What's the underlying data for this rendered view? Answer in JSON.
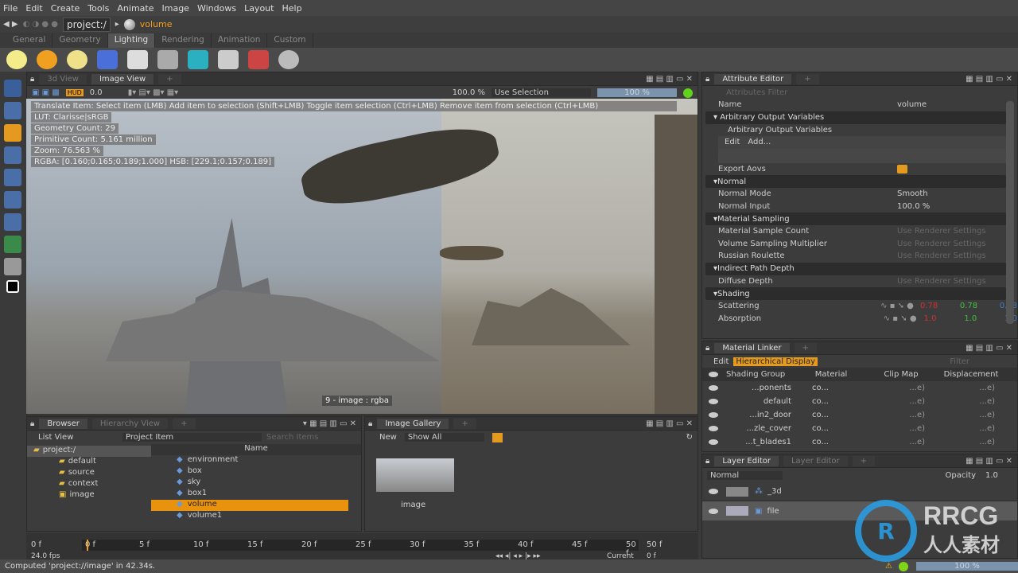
{
  "menu": [
    "File",
    "Edit",
    "Create",
    "Tools",
    "Animate",
    "Image",
    "Windows",
    "Layout",
    "Help"
  ],
  "nav": {
    "path": "project:/",
    "selected": "volume"
  },
  "shelf_tabs": [
    "General",
    "Geometry",
    "Lighting",
    "Rendering",
    "Animation",
    "Custom"
  ],
  "shelf_active": "Lighting",
  "shelf_icons": [
    "bulb-light-icon",
    "sun-light-icon",
    "point-light-icon",
    "spot-light-icon",
    "area-light-icon",
    "line-light-icon",
    "sphere-light-icon",
    "distant-light-icon",
    "gi-light-icon",
    "env-light-icon"
  ],
  "viewport": {
    "tabs": [
      "3d View",
      "Image View"
    ],
    "active_tab": "Image View",
    "exposure": "0.0",
    "zoom": "100.0 %",
    "selection_mode": "Use Selection",
    "progress": "100 %",
    "hud": [
      "Translate Item: Select item (LMB)  Add item to selection (Shift+LMB)  Toggle item selection (Ctrl+LMB)  Remove item from selection (Ctrl+LMB)",
      "LUT: Clarisse|sRGB",
      "Geometry Count: 29",
      "Primitive Count: 5.161 million",
      "Zoom: 76.563 %",
      "RGBA: [0.160;0.165;0.189;1.000] HSB: [229.1;0.157;0.189]"
    ],
    "image_label": "9 - image : rgba"
  },
  "attribute_editor": {
    "title": "Attribute Editor",
    "filter_placeholder": "Attributes Filter",
    "name_label": "Name",
    "name_value": "volume",
    "sections": [
      {
        "title": "Arbitrary Output Variables",
        "rows": []
      },
      {
        "title": "Normal",
        "rows": [
          {
            "label": "Normal Mode",
            "value": "Smooth"
          },
          {
            "label": "Normal Input",
            "value": "100.0 %"
          }
        ]
      },
      {
        "title": "Material Sampling",
        "rows": [
          {
            "label": "Material Sample Count",
            "value": "Use Renderer Settings"
          },
          {
            "label": "Volume Sampling Multiplier",
            "value": "Use Renderer Settings"
          },
          {
            "label": "Russian Roulette",
            "value": "Use Renderer Settings"
          }
        ]
      },
      {
        "title": "Indirect Path Depth",
        "rows": [
          {
            "label": "Diffuse Depth",
            "value": "Use Renderer Settings"
          }
        ]
      },
      {
        "title": "Shading",
        "rows": []
      }
    ],
    "aov_sub": "Arbitrary Output Variables",
    "aov_edit": "Edit",
    "aov_add": "Add...",
    "export_aovs": "Export Aovs",
    "scattering": {
      "label": "Scattering",
      "r": "0.78",
      "g": "0.78",
      "b": "0.78"
    },
    "absorption": {
      "label": "Absorption",
      "r": "1.0",
      "g": "1.0",
      "b": "1.0"
    }
  },
  "material_linker": {
    "title": "Material Linker",
    "edit": "Edit",
    "mode": "Hierarchical Display",
    "filter_placeholder": "Filter",
    "columns": [
      "Shading Group",
      "Material",
      "Clip Map",
      "Displacement"
    ],
    "rows": [
      "...ponents",
      "default",
      "...in2_door",
      "...zle_cover",
      "...t_blades1"
    ],
    "material_value": "co...",
    "map_value": "...e)"
  },
  "layer_editor": {
    "tabs": [
      "Layer Editor",
      "Layer Editor"
    ],
    "blend": "Normal",
    "opacity_label": "Opacity",
    "opacity": "1.0",
    "layers": [
      "_3d",
      "file"
    ]
  },
  "browser": {
    "tabs": [
      "Browser",
      "Hierarchy View"
    ],
    "view": "List View",
    "type": "Project Item",
    "search_placeholder": "Search Items",
    "tree": [
      "project:/",
      "default",
      "source",
      "context",
      "image"
    ],
    "column": "Name",
    "items": [
      "environment",
      "box",
      "sky",
      "box1",
      "volume",
      "volume1"
    ],
    "selected": "volume"
  },
  "gallery": {
    "title": "Image Gallery",
    "new": "New",
    "filter": "Show All",
    "thumb": "image"
  },
  "timeline": {
    "start": "0 f",
    "end": "50 f",
    "fps": "24.0 fps",
    "current_label": "Current",
    "current": "0 f",
    "ticks": [
      "0 f",
      "5 f",
      "10 f",
      "15 f",
      "20 f",
      "25 f",
      "30 f",
      "35 f",
      "40 f",
      "45 f",
      "50 f"
    ]
  },
  "status": {
    "message": "Computed 'project://image' in 42.34s.",
    "progress": "100 %"
  },
  "watermark": "RRCG 人人素材",
  "colors": {
    "accent": "#f0a020",
    "selection": "#e8920e"
  }
}
